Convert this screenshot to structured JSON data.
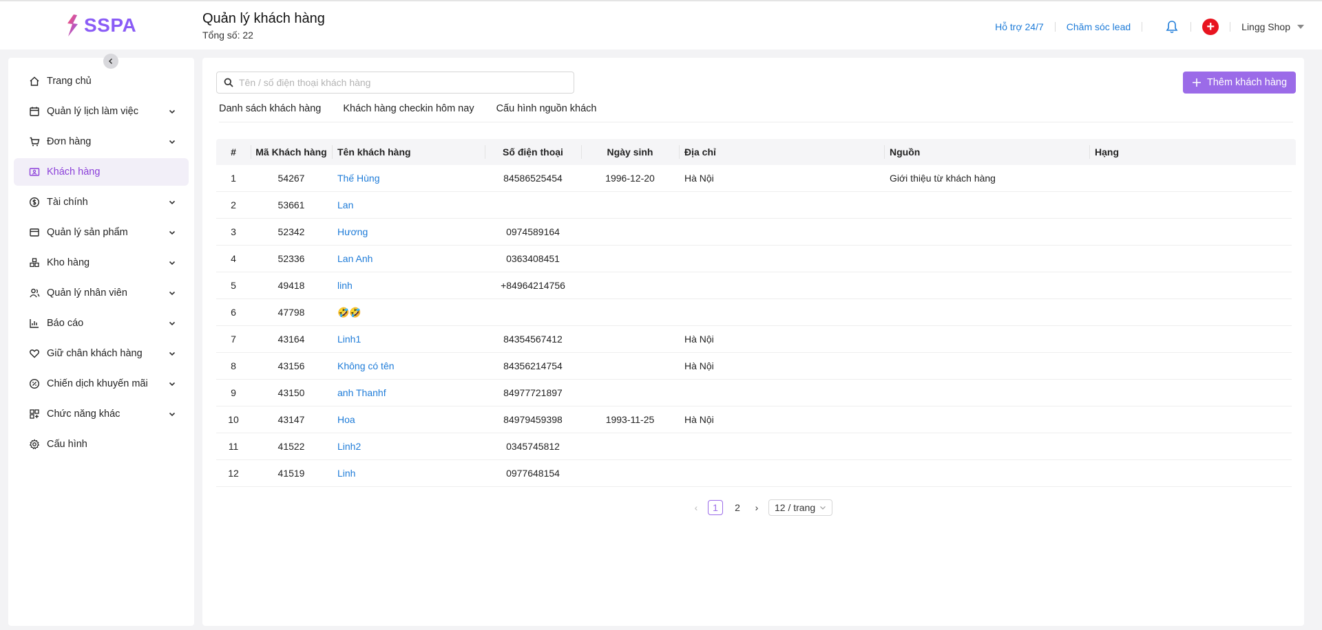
{
  "brand": {
    "name": "SSPA"
  },
  "page": {
    "title": "Quản lý khách hàng",
    "count": "Tổng số: 22"
  },
  "topbar": {
    "support": "Hỗ trợ 24/7",
    "lead": "Chăm sóc lead",
    "shop": "Lingg Shop"
  },
  "sidebar": {
    "items": [
      {
        "label": "Trang chủ",
        "icon": "home-icon",
        "expandable": false,
        "active": false
      },
      {
        "label": "Quản lý lịch làm việc",
        "icon": "calendar-icon",
        "expandable": true,
        "active": false
      },
      {
        "label": "Đơn hàng",
        "icon": "cart-icon",
        "expandable": true,
        "active": false
      },
      {
        "label": "Khách hàng",
        "icon": "customer-card-icon",
        "expandable": false,
        "active": true
      },
      {
        "label": "Tài chính",
        "icon": "dollar-icon",
        "expandable": true,
        "active": false
      },
      {
        "label": "Quản lý sản phẩm",
        "icon": "box-icon",
        "expandable": true,
        "active": false
      },
      {
        "label": "Kho hàng",
        "icon": "warehouse-icon",
        "expandable": true,
        "active": false
      },
      {
        "label": "Quản lý nhân viên",
        "icon": "staff-icon",
        "expandable": true,
        "active": false
      },
      {
        "label": "Báo cáo",
        "icon": "chart-icon",
        "expandable": true,
        "active": false
      },
      {
        "label": "Giữ chân khách hàng",
        "icon": "heart-icon",
        "expandable": true,
        "active": false
      },
      {
        "label": "Chiến dịch khuyến mãi",
        "icon": "discount-icon",
        "expandable": true,
        "active": false
      },
      {
        "label": "Chức năng khác",
        "icon": "grid-icon",
        "expandable": true,
        "active": false
      },
      {
        "label": "Cấu hình",
        "icon": "gear-icon",
        "expandable": false,
        "active": false
      }
    ]
  },
  "search": {
    "placeholder": "Tên / số điện thoại khách hàng",
    "value": ""
  },
  "add_button": {
    "label": "Thêm khách hàng"
  },
  "tabs": [
    {
      "label": "Danh sách khách hàng",
      "active": true
    },
    {
      "label": "Khách hàng checkin hôm nay",
      "active": false
    },
    {
      "label": "Cấu hình nguồn khách",
      "active": false
    }
  ],
  "table": {
    "columns": [
      "#",
      "Mã Khách hàng",
      "Tên khách hàng",
      "Số điện thoại",
      "Ngày sinh",
      "Địa chỉ",
      "Nguồn",
      "Hạng"
    ],
    "rows": [
      {
        "idx": "1",
        "code": "54267",
        "name": "Thế Hùng",
        "phone": "84586525454",
        "dob": "1996-12-20",
        "address": "Hà Nội",
        "source": "Giới thiệu từ khách hàng",
        "rank": ""
      },
      {
        "idx": "2",
        "code": "53661",
        "name": "Lan",
        "phone": "",
        "dob": "",
        "address": "",
        "source": "",
        "rank": ""
      },
      {
        "idx": "3",
        "code": "52342",
        "name": "Hương",
        "phone": "0974589164",
        "dob": "",
        "address": "",
        "source": "",
        "rank": ""
      },
      {
        "idx": "4",
        "code": "52336",
        "name": "Lan Anh",
        "phone": "0363408451",
        "dob": "",
        "address": "",
        "source": "",
        "rank": ""
      },
      {
        "idx": "5",
        "code": "49418",
        "name": "linh",
        "phone": "+84964214756",
        "dob": "",
        "address": "",
        "source": "",
        "rank": ""
      },
      {
        "idx": "6",
        "code": "47798",
        "name": "🤣🤣",
        "phone": "",
        "dob": "",
        "address": "",
        "source": "",
        "rank": ""
      },
      {
        "idx": "7",
        "code": "43164",
        "name": "Linh1",
        "phone": "84354567412",
        "dob": "",
        "address": "Hà Nội",
        "source": "",
        "rank": ""
      },
      {
        "idx": "8",
        "code": "43156",
        "name": "Không có tên",
        "phone": "84356214754",
        "dob": "",
        "address": "Hà Nội",
        "source": "",
        "rank": ""
      },
      {
        "idx": "9",
        "code": "43150",
        "name": "anh Thanhf",
        "phone": "84977721897",
        "dob": "",
        "address": "",
        "source": "",
        "rank": ""
      },
      {
        "idx": "10",
        "code": "43147",
        "name": "Hoa",
        "phone": "84979459398",
        "dob": "1993-11-25",
        "address": "Hà Nội",
        "source": "",
        "rank": ""
      },
      {
        "idx": "11",
        "code": "41522",
        "name": "Linh2",
        "phone": "0345745812",
        "dob": "",
        "address": "",
        "source": "",
        "rank": ""
      },
      {
        "idx": "12",
        "code": "41519",
        "name": "Linh",
        "phone": "0977648154",
        "dob": "",
        "address": "",
        "source": "",
        "rank": ""
      }
    ]
  },
  "pagination": {
    "pages": [
      "1",
      "2"
    ],
    "current": "1",
    "page_size": "12 / trang"
  },
  "colors": {
    "accent": "#9b6be8",
    "link": "#1d7bd8",
    "active_bg": "#f2eff8",
    "alert": "#e8141f"
  }
}
